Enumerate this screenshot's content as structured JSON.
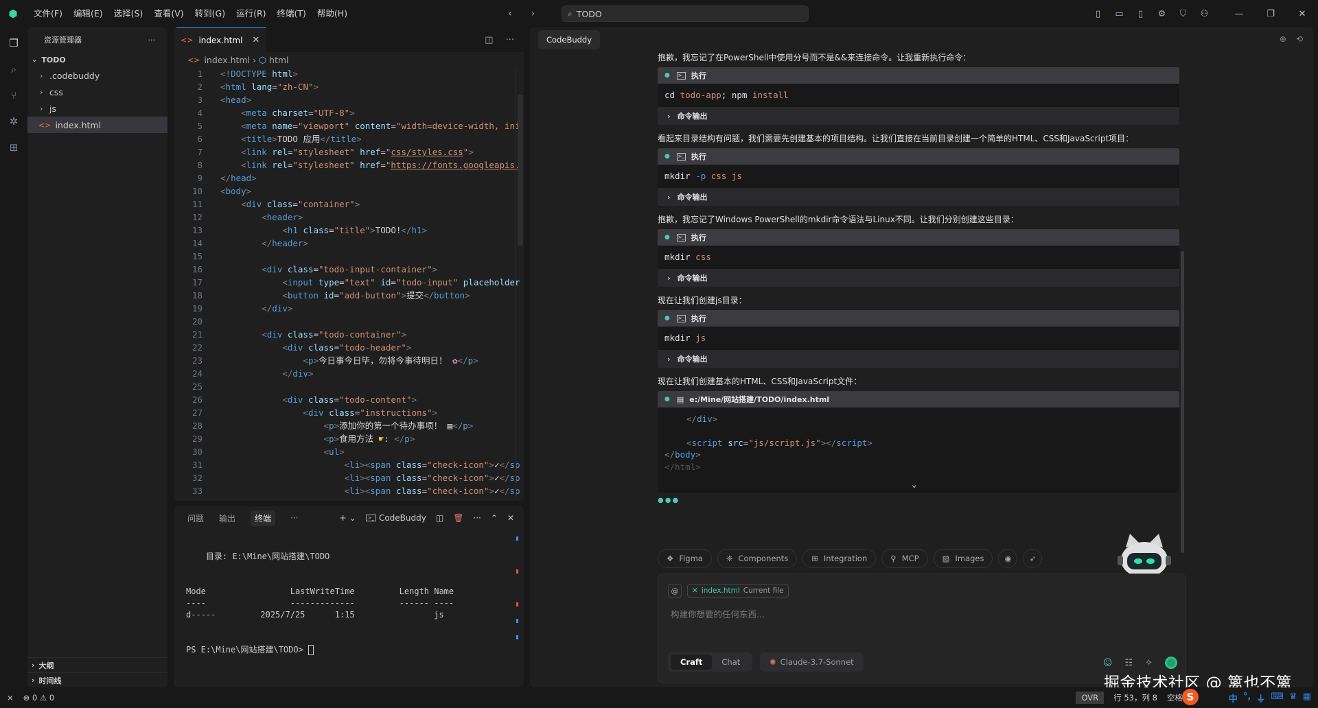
{
  "titlebar": {
    "menu": [
      "文件(F)",
      "编辑(E)",
      "选择(S)",
      "查看(V)",
      "转到(G)",
      "运行(R)",
      "终端(T)",
      "帮助(H)"
    ],
    "search_text": "TODO",
    "icons": [
      "layout-sidebar-left-icon",
      "layout-panel-icon",
      "layout-sidebar-right-icon",
      "gear-icon",
      "shield-icon",
      "account-icon"
    ]
  },
  "explorer": {
    "title": "资源管理器",
    "root": "TODO",
    "items": [
      {
        "label": ".codebuddy",
        "type": "folder"
      },
      {
        "label": "css",
        "type": "folder"
      },
      {
        "label": "js",
        "type": "folder"
      },
      {
        "label": "index.html",
        "type": "html"
      }
    ],
    "outline": "大纲",
    "timeline": "时间线"
  },
  "editor": {
    "tab": "index.html",
    "breadcrumb": [
      "index.html",
      "html"
    ],
    "line_numbers": [
      1,
      2,
      3,
      4,
      5,
      6,
      7,
      8,
      9,
      10,
      11,
      12,
      13,
      14,
      15,
      16,
      17,
      18,
      19,
      20,
      21,
      22,
      23,
      24,
      25,
      26,
      27,
      28,
      29,
      30,
      31,
      32,
      33
    ]
  },
  "panel": {
    "tabs": [
      "问题",
      "输出",
      "终端"
    ],
    "active_tab": "终端",
    "terminal_name": "CodeBuddy",
    "terminal": {
      "dir_line": "    目录: E:\\Mine\\网站搭建\\TODO",
      "header": "Mode                 LastWriteTime         Length Name",
      "rule": "----                 -------------         ------ ----",
      "row": "d-----         2025/7/25      1:15                js",
      "prompt": "PS E:\\Mine\\网站搭建\\TODO> "
    }
  },
  "chat": {
    "tab": "CodeBuddy",
    "messages": [
      {
        "text": "抱歉，我忘记了在PowerShell中使用分号而不是&&来连接命令。让我重新执行命令：",
        "label": "执行",
        "cmd": [
          "cd",
          " todo-app",
          "; npm",
          " install"
        ],
        "out": "命令输出"
      },
      {
        "text": "看起来目录结构有问题，我们需要先创建基本的项目结构。让我们直接在当前目录创建一个简单的HTML、CSS和JavaScript项目：",
        "label": "执行",
        "cmd": [
          "mkdir",
          " -p",
          " css js"
        ],
        "out": "命令输出"
      },
      {
        "text": "抱歉，我忘记了Windows PowerShell的mkdir命令语法与Linux不同。让我们分别创建这些目录：",
        "label": "执行",
        "cmd": [
          "mkdir",
          " css"
        ],
        "out": "命令输出"
      },
      {
        "text": "现在让我们创建js目录：",
        "label": "执行",
        "cmd": [
          "mkdir",
          " js"
        ],
        "out": "命令输出"
      }
    ],
    "file_message": "现在让我们创建基本的HTML、CSS和JavaScript文件：",
    "file_path": "e:/Mine/网站搭建/TODO/index.html",
    "chips": [
      "Figma",
      "Components",
      "Integration",
      "MCP",
      "Images"
    ],
    "context_file": "index.html",
    "context_label": "Current file",
    "placeholder": "构建你想要的任何东西...",
    "modes": [
      "Craft",
      "Chat"
    ],
    "active_mode": "Craft",
    "model": "Claude-3.7-Sonnet"
  },
  "statusbar": {
    "errors": "0",
    "warnings": "0",
    "ovr": "OVR",
    "position": "行 53，列 8",
    "spaces": "空格: 4"
  },
  "watermark": "掘金技术社区 @ 篱也不篱",
  "colors": {
    "accent": "#3794ff",
    "brand": "#3fd3a0",
    "html_icon": "#e37933"
  }
}
